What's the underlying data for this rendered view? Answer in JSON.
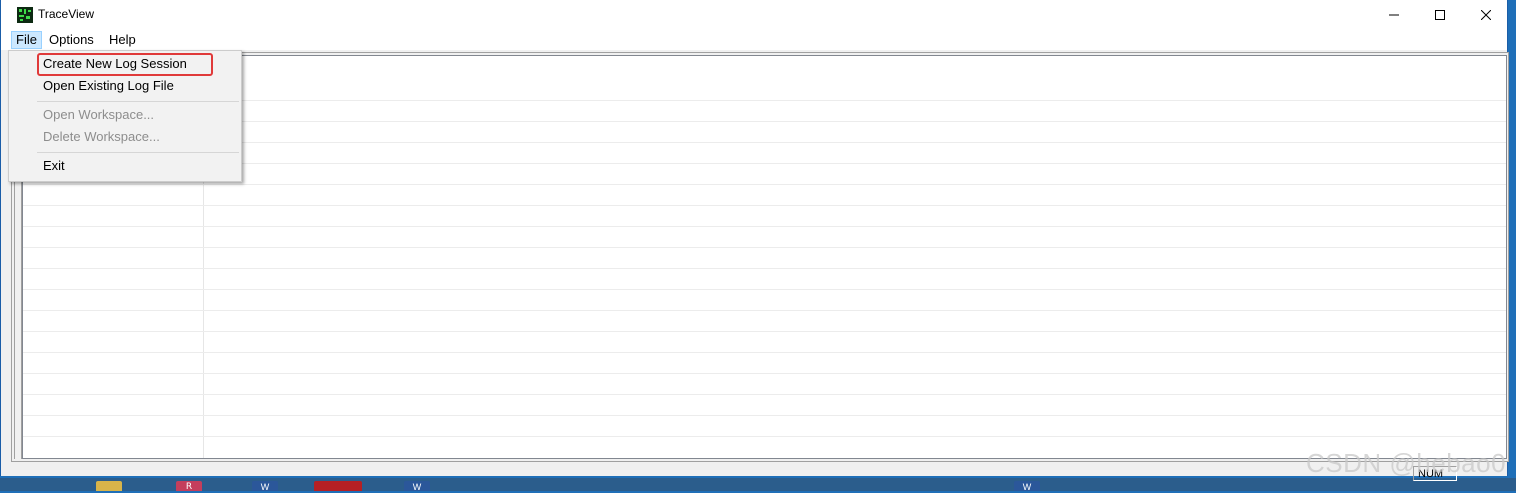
{
  "window": {
    "title": "TraceView",
    "accent_color": "#1a5da8",
    "controls": [
      "minimize-icon",
      "maximize-icon",
      "close-icon"
    ]
  },
  "menubar": {
    "items": [
      {
        "label": "File",
        "active": true
      },
      {
        "label": "Options",
        "active": false
      },
      {
        "label": "Help",
        "active": false
      }
    ]
  },
  "file_menu": {
    "items": [
      {
        "label": "Create New Log Session",
        "enabled": true,
        "highlighted": true
      },
      {
        "label": "Open Existing Log File",
        "enabled": true
      },
      {
        "label": "Open Workspace...",
        "enabled": false
      },
      {
        "label": "Delete Workspace...",
        "enabled": false
      },
      {
        "label": "Exit",
        "enabled": true
      }
    ],
    "highlight_color": "#e03a3a"
  },
  "statusbar": {
    "num_indicator": "NUM"
  },
  "watermark": "CSDN @hebao0",
  "taskbar": {
    "apps": [
      "word-icon",
      "r-icon",
      "word-icon",
      "red-app-icon",
      "word-icon",
      "word-icon"
    ]
  }
}
